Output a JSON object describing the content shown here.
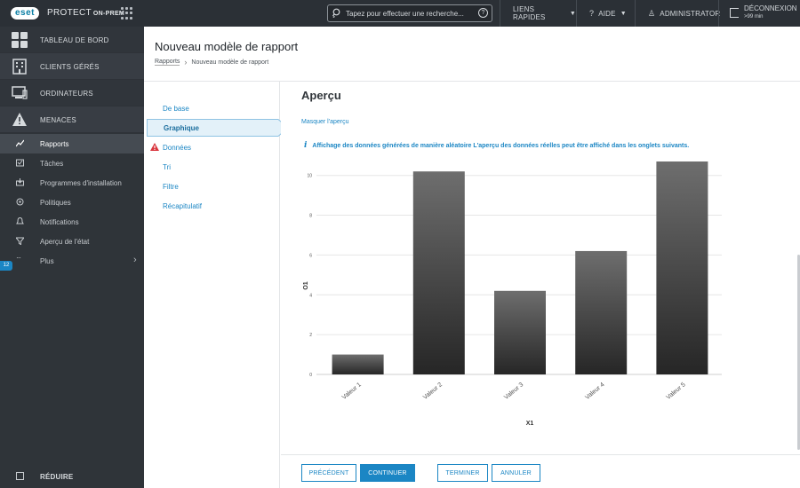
{
  "topbar": {
    "logo": "eset",
    "product_name": "PROTECT",
    "product_suffix": "ON-PREM",
    "search_placeholder": "Tapez pour effectuer une recherche...",
    "help_glyph": "?",
    "quick_links": "LIENS RAPIDES",
    "help": "AIDE",
    "user": "ADMINISTRATOR",
    "logout": "DÉCONNEXION",
    "logout_time": ">99 min"
  },
  "sidebar": {
    "main_items": [
      {
        "label": "TABLEAU DE BORD",
        "icon": "dashboard-icon"
      },
      {
        "label": "CLIENTS GÉRÉS",
        "icon": "building-icon"
      },
      {
        "label": "ORDINATEURS",
        "icon": "computers-icon"
      },
      {
        "label": "MENACES",
        "icon": "warning-icon"
      }
    ],
    "sub_items": [
      {
        "label": "Rapports",
        "icon": "reports-icon",
        "active": true
      },
      {
        "label": "Tâches",
        "icon": "tasks-icon"
      },
      {
        "label": "Programmes d'installation",
        "icon": "installer-icon"
      },
      {
        "label": "Politiques",
        "icon": "policies-icon"
      },
      {
        "label": "Notifications",
        "icon": "notifications-icon"
      },
      {
        "label": "Aperçu de l'état",
        "icon": "status-icon"
      },
      {
        "label": "Plus",
        "icon": "more-icon"
      }
    ],
    "status_badge": "12",
    "collapse": "RÉDUIRE"
  },
  "header": {
    "title": "Nouveau modèle de rapport",
    "breadcrumb": [
      "Rapports",
      "Nouveau modèle de rapport"
    ]
  },
  "steps": [
    {
      "label": "De base"
    },
    {
      "label": "Graphique",
      "active": true
    },
    {
      "label": "Données",
      "warning": true
    },
    {
      "label": "Tri"
    },
    {
      "label": "Filtre"
    },
    {
      "label": "Récapitulatif"
    }
  ],
  "preview": {
    "title": "Aperçu",
    "hide_link": "Masquer l'aperçu",
    "info_icon": "i",
    "info": "Affichage des données générées de manière aléatoire L'aperçu des données réelles peut être affiché dans les onglets suivants."
  },
  "chart_data": {
    "type": "bar",
    "categories": [
      "Valeur 1",
      "Valeur 2",
      "Valeur 3",
      "Valeur 4",
      "Valeur 5"
    ],
    "values": [
      1,
      10.2,
      4.2,
      6.2,
      10.7
    ],
    "xlabel": "X1",
    "ylabel": "O1",
    "ylim": [
      0,
      10.7
    ],
    "yticks": [
      0,
      2,
      4,
      6,
      8,
      10
    ],
    "grid": true,
    "bar_color_top": "#6e6e6e",
    "bar_color_bottom": "#262626"
  },
  "footer": {
    "previous": "PRÉCÉDENT",
    "continue": "CONTINUER",
    "finish": "TERMINER",
    "cancel": "ANNULER"
  },
  "colors": {
    "accent": "#1b86c4",
    "topbar": "#2b3036",
    "sidebar": "#383d44",
    "warning": "#d9363e"
  }
}
